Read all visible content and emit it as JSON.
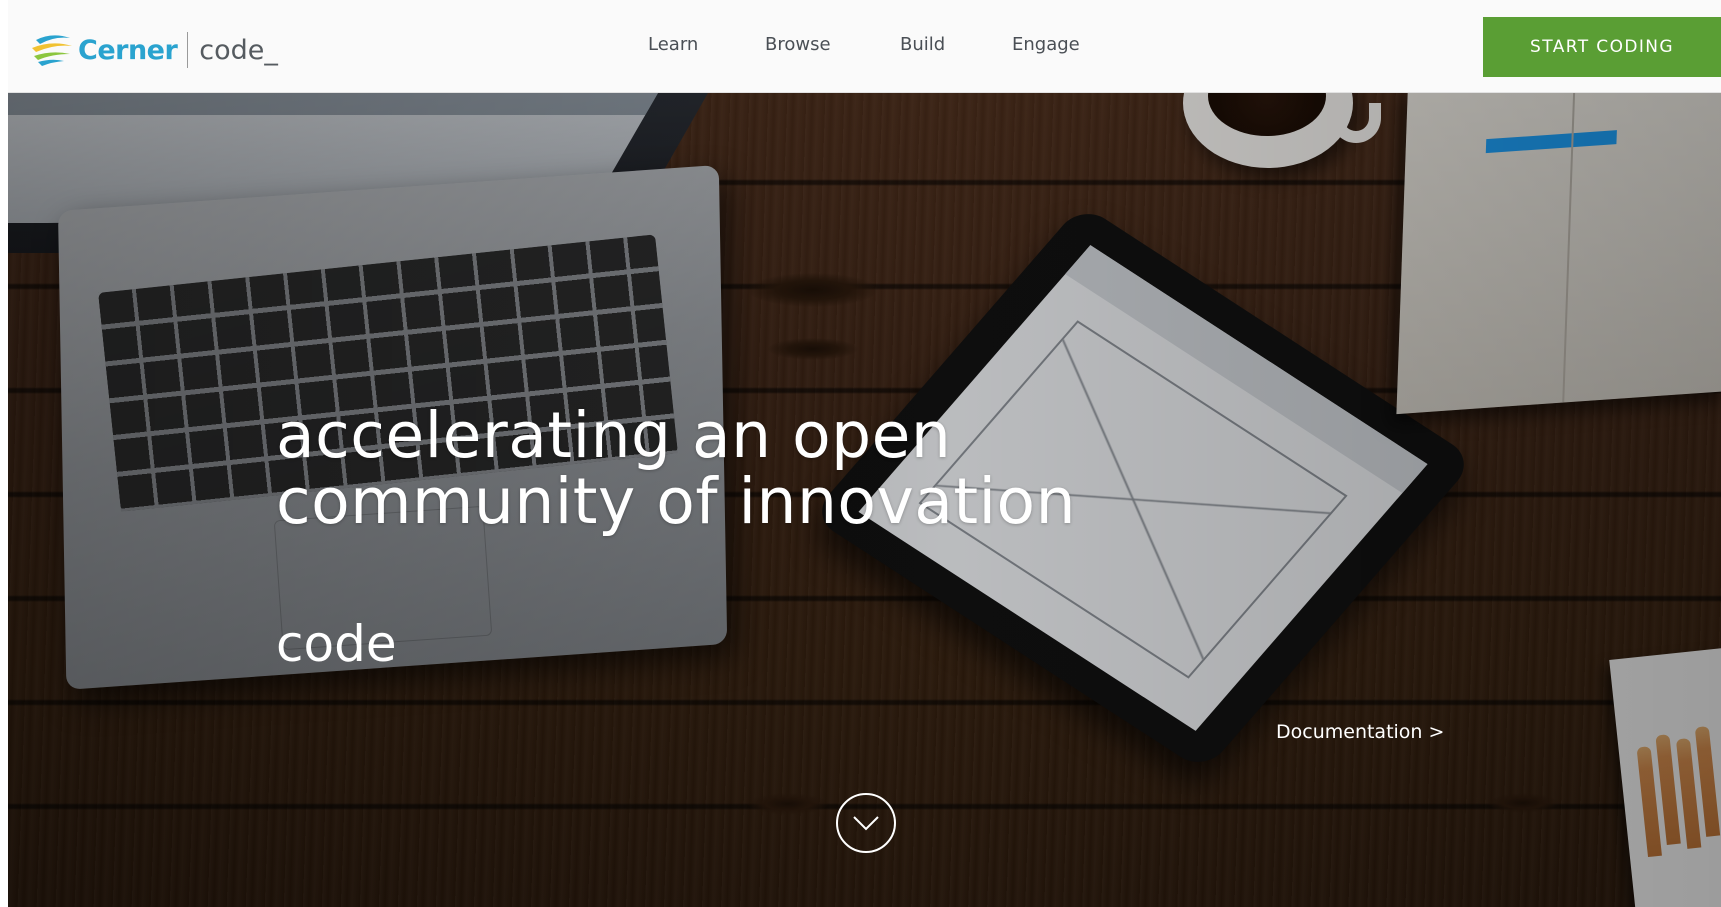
{
  "header": {
    "brand": "Cerner",
    "product": "code_",
    "nav": [
      "Learn",
      "Browse",
      "Build",
      "Engage"
    ],
    "cta_label": "START CODING"
  },
  "hero": {
    "headline_line1": "accelerating an open",
    "headline_line2": "community of innovation",
    "subhead": "code",
    "doc_link": "Documentation  >"
  },
  "icons": {
    "logo": "cerner-logo-icon",
    "scroll": "chevron-down-icon"
  },
  "colors": {
    "brand_blue": "#2aa3cf",
    "brand_green": "#5a9e34",
    "brand_yellow": "#f1c232",
    "cta_background": "#5a9e34",
    "header_background": "#fafafa",
    "nav_text": "#4a4f55",
    "hero_text": "#ffffff"
  }
}
